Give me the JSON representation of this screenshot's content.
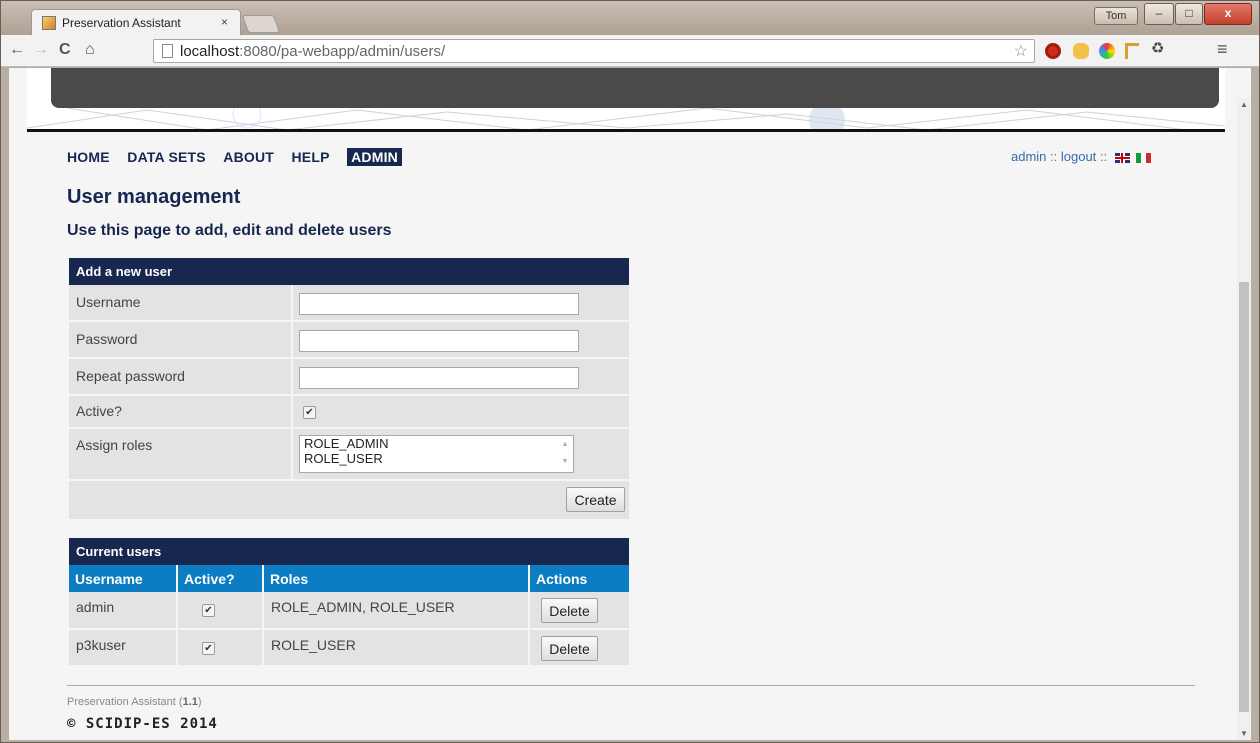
{
  "browser": {
    "tab_title": "Preservation Assistant",
    "tab_close": "×",
    "user_badge": "Tom",
    "url_host": "localhost",
    "url_rest": ":8080/pa-webapp/admin/users/",
    "win_min": "–",
    "win_max": "□",
    "win_close": "x"
  },
  "nav": {
    "items": [
      {
        "label": "HOME",
        "active": false
      },
      {
        "label": "DATA SETS",
        "active": false
      },
      {
        "label": "ABOUT",
        "active": false
      },
      {
        "label": "HELP",
        "active": false
      },
      {
        "label": "ADMIN",
        "active": true
      }
    ],
    "user_link": "admin",
    "separator": " :: ",
    "logout_link": "logout"
  },
  "page": {
    "title": "User management",
    "subtitle": "Use this page to add, edit and delete users"
  },
  "add_user": {
    "header": "Add a new user",
    "username_label": "Username",
    "username_value": "",
    "password_label": "Password",
    "password_value": "",
    "repeat_label": "Repeat password",
    "repeat_value": "",
    "active_label": "Active?",
    "active_checked": true,
    "roles_label": "Assign roles",
    "role_options": [
      "ROLE_ADMIN",
      "ROLE_USER"
    ],
    "create_label": "Create"
  },
  "current_users": {
    "header": "Current users",
    "columns": [
      "Username",
      "Active?",
      "Roles",
      "Actions"
    ],
    "rows": [
      {
        "username": "admin",
        "active": true,
        "roles": "ROLE_ADMIN, ROLE_USER",
        "action": "Delete"
      },
      {
        "username": "p3kuser",
        "active": true,
        "roles": "ROLE_USER",
        "action": "Delete"
      }
    ]
  },
  "footer": {
    "app_name": "Preservation Assistant",
    "version": "1.1",
    "copyright": "© SCIDIP-ES 2014"
  },
  "colors": {
    "navy": "#17274f",
    "table_header_blue": "#0c7cc3",
    "row_gray": "#e3e3e3"
  }
}
